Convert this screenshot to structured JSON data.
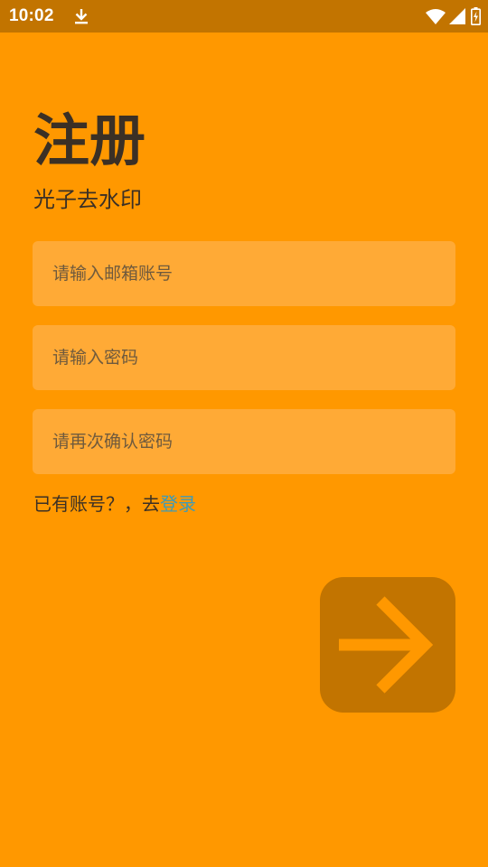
{
  "status_bar": {
    "time": "10:02",
    "icons": [
      "download-icon",
      "wifi-icon",
      "signal-icon",
      "battery-charging-icon"
    ]
  },
  "header": {
    "title": "注册",
    "subtitle": "光子去水印"
  },
  "form": {
    "email_placeholder": "请输入邮箱账号",
    "password_placeholder": "请输入密码",
    "confirm_placeholder": "请再次确认密码"
  },
  "login_prompt": {
    "text": "已有账号？，去",
    "link_label": "登录"
  },
  "next_button": {
    "icon": "arrow-right-icon"
  },
  "colors": {
    "background": "#FF9800",
    "status_bar": "#C27400",
    "field_background": "#FFAA36",
    "button_background": "#C27400",
    "link": "#3F9BB6",
    "text": "#3B3025"
  }
}
